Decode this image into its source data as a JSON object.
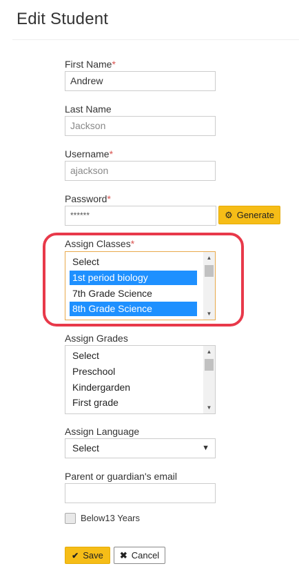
{
  "page": {
    "title": "Edit Student"
  },
  "fields": {
    "first_name": {
      "label": "First Name",
      "required": "*",
      "value": "Andrew"
    },
    "last_name": {
      "label": "Last Name",
      "value": "Jackson"
    },
    "username": {
      "label": "Username",
      "required": "*",
      "value": "ajackson"
    },
    "password": {
      "label": "Password",
      "required": "*",
      "value": "******",
      "generate_label": "Generate"
    },
    "assign_classes": {
      "label": "Assign Classes",
      "required": "*",
      "options": [
        "Select",
        "1st period biology",
        "7th Grade Science",
        "8th Grade Science"
      ],
      "selected": [
        "1st period biology",
        "8th Grade Science"
      ]
    },
    "assign_grades": {
      "label": "Assign Grades",
      "options": [
        "Select",
        "Preschool",
        "Kindergarden",
        "First grade"
      ]
    },
    "assign_language": {
      "label": "Assign Language",
      "value": "Select"
    },
    "parent_email": {
      "label": "Parent or guardian's email",
      "value": ""
    },
    "below13": {
      "label": "Below13 Years",
      "checked": false
    }
  },
  "actions": {
    "save_label": "Save",
    "cancel_label": "Cancel"
  },
  "colors": {
    "accent": "#f6bd17",
    "selection": "#1e90ff",
    "highlight": "#e8394a",
    "required": "#d9534f"
  },
  "icons": {
    "generate": "gear-icon",
    "save": "check-icon",
    "cancel": "close-icon",
    "language": "caret-down-icon"
  }
}
